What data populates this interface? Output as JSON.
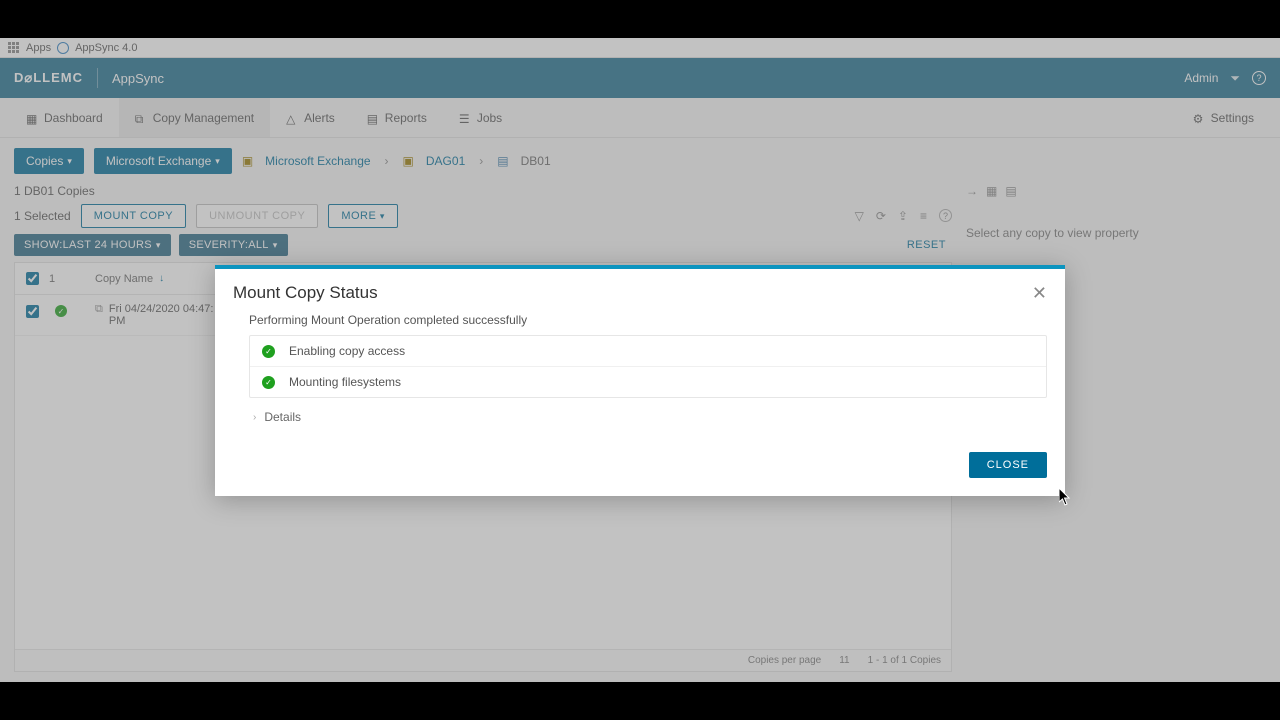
{
  "browser": {
    "apps_label": "Apps",
    "tab_label": "AppSync 4.0"
  },
  "topbar": {
    "brand": "D⌀LLEMC",
    "product": "AppSync",
    "user": "Admin"
  },
  "tabs": {
    "dashboard": "Dashboard",
    "copy_mgmt": "Copy Management",
    "alerts": "Alerts",
    "reports": "Reports",
    "jobs": "Jobs",
    "settings": "Settings"
  },
  "subbar": {
    "copies_btn": "Copies",
    "scope_btn": "Microsoft Exchange",
    "crumbs": {
      "c1": "Microsoft Exchange",
      "c2": "DAG01",
      "c3": "DB01"
    }
  },
  "panel": {
    "heading": "1 DB01 Copies",
    "selected": "1 Selected",
    "mount": "MOUNT COPY",
    "unmount": "UNMOUNT COPY",
    "more": "MORE"
  },
  "filters": {
    "time": "SHOW:LAST 24 HOURS",
    "sev": "SEVERITY:ALL",
    "reset": "RESET"
  },
  "table": {
    "col_num": "1",
    "col_name": "Copy Name",
    "row0_date": "Fri 04/24/2020 04:47:",
    "row0_pm": "PM",
    "footer_pp": "Copies per page",
    "footer_ppv": "11",
    "footer_range": "1 - 1 of 1 Copies"
  },
  "side": {
    "hint": "Select any copy to view property"
  },
  "modal": {
    "title": "Mount Copy Status",
    "message": "Performing Mount Operation completed successfully",
    "step1": "Enabling copy access",
    "step2": "Mounting filesystems",
    "details": "Details",
    "close": "CLOSE"
  }
}
